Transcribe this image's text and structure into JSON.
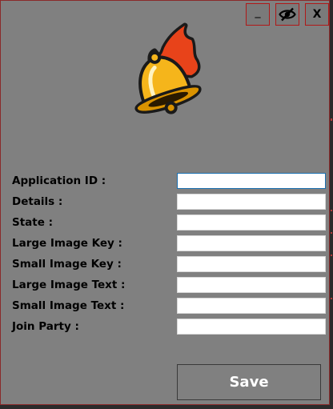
{
  "window_buttons": {
    "minimize_label": "_",
    "close_label": "X",
    "hide_icon": "eye-off-icon"
  },
  "logo": {
    "icon": "flaming-bell-icon",
    "colors": {
      "bell": "#f5b51b",
      "bell_shade": "#d99200",
      "flame": "#e8431a",
      "outline": "#1a1a1a"
    }
  },
  "form": {
    "fields": [
      {
        "label": "Application ID :",
        "value": "",
        "focused": true
      },
      {
        "label": "Details :",
        "value": ""
      },
      {
        "label": "State :",
        "value": ""
      },
      {
        "label": "Large Image Key :",
        "value": ""
      },
      {
        "label": "Small Image Key :",
        "value": ""
      },
      {
        "label": "Large Image Text :",
        "value": ""
      },
      {
        "label": "Small Image Text :",
        "value": ""
      },
      {
        "label": "Join Party :",
        "value": ""
      }
    ]
  },
  "save_button": {
    "label": "Save"
  },
  "colors": {
    "background": "#808080",
    "window_border": "#8a2a2a",
    "button_border": "#b01818",
    "focus_border": "#1a6fb0"
  }
}
